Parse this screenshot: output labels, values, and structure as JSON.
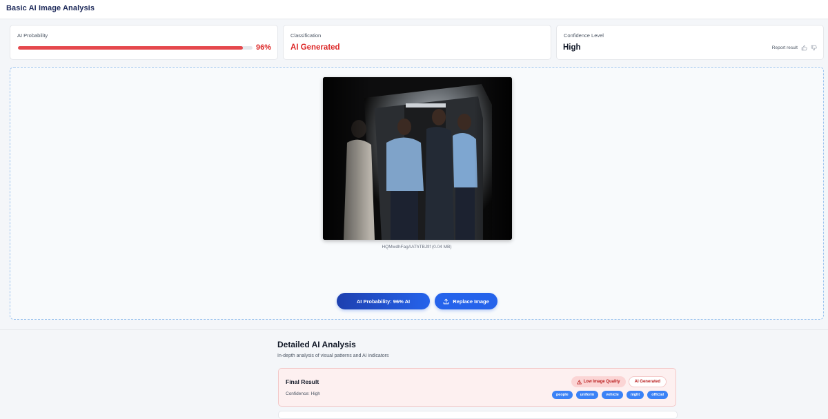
{
  "header": {
    "title": "Basic AI Image Analysis"
  },
  "cards": {
    "probability": {
      "label": "AI Probability",
      "value": "96%",
      "fraction": 0.96
    },
    "classification": {
      "label": "Classification",
      "value": "AI Generated"
    },
    "confidence": {
      "label": "Confidence Level",
      "value": "High",
      "report_label": "Report result"
    }
  },
  "upload": {
    "file_caption": "HQMwdhFagAAThTBJfif (0.04 MB)",
    "probability_button": "AI Probability: 96% AI",
    "replace_button": "Replace Image"
  },
  "details": {
    "title": "Detailed AI Analysis",
    "subtitle": "In-depth analysis of visual patterns and AI indicators",
    "result": {
      "title": "Final Result",
      "confidence": "Confidence: High",
      "badges": [
        "Low Image Quality",
        "AI Generated"
      ],
      "tags": [
        "people",
        "uniform",
        "vehicle",
        "night",
        "official"
      ]
    }
  },
  "colors": {
    "accent": "#2563eb",
    "danger": "#dc2626",
    "progress": "#e5484d"
  },
  "icons": [
    "thumbs-up-icon",
    "thumbs-down-icon",
    "upload-icon",
    "warning-icon"
  ]
}
